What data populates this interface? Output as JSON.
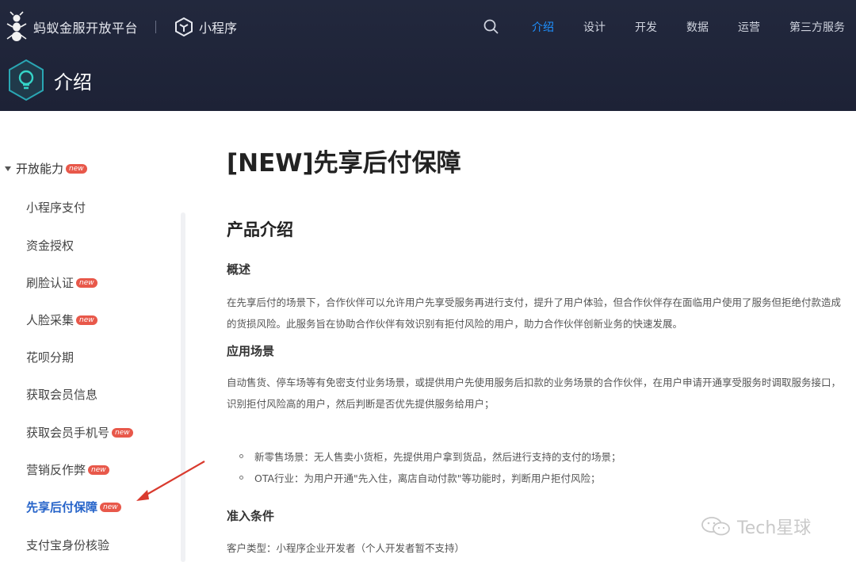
{
  "header": {
    "brand": "蚂蚁金服开放平台",
    "product": "小程序",
    "nav": [
      "介绍",
      "设计",
      "开发",
      "数据",
      "运营",
      "第三方服务"
    ],
    "active_nav": "介绍",
    "section_title": "介绍"
  },
  "sidebar": {
    "group": {
      "label": "开放能力",
      "badge": "new"
    },
    "items": [
      {
        "label": "小程序支付",
        "badge": ""
      },
      {
        "label": "资金授权",
        "badge": ""
      },
      {
        "label": "刷脸认证",
        "badge": "new"
      },
      {
        "label": "人脸采集",
        "badge": "new"
      },
      {
        "label": "花呗分期",
        "badge": ""
      },
      {
        "label": "获取会员信息",
        "badge": ""
      },
      {
        "label": "获取会员手机号",
        "badge": "new"
      },
      {
        "label": "营销反作弊",
        "badge": "new"
      },
      {
        "label": "先享后付保障",
        "badge": "new"
      },
      {
        "label": "支付宝身份核验",
        "badge": ""
      }
    ]
  },
  "main": {
    "title": "[NEW]先享后付保障",
    "intro_heading": "产品介绍",
    "overview_heading": "概述",
    "overview_text": "在先享后付的场景下，合作伙伴可以允许用户先享受服务再进行支付，提升了用户体验，但合作伙伴存在面临用户使用了服务但拒绝付款造成的货损风险。此服务旨在协助合作伙伴有效识别有拒付风险的用户，助力合作伙伴创新业务的快速发展。",
    "scenario_heading": "应用场景",
    "scenario_text": "自动售货、停车场等有免密支付业务场景，或提供用户先使用服务后扣款的业务场景的合作伙伴，在用户申请开通享受服务时调取服务接口，识别拒付风险高的用户，然后判断是否优先提供服务给用户；",
    "bullets": [
      "新零售场景：无人售卖小货柜，先提供用户拿到货品，然后进行支持的支付的场景；",
      "OTA行业：为用户开通\"先入住，离店自动付款\"等功能时，判断用户拒付风险；"
    ],
    "access_heading": "准入条件",
    "access_text": "客户类型：小程序企业开发者（个人开发者暂不支持）"
  },
  "watermark": {
    "text": "Tech星球"
  }
}
